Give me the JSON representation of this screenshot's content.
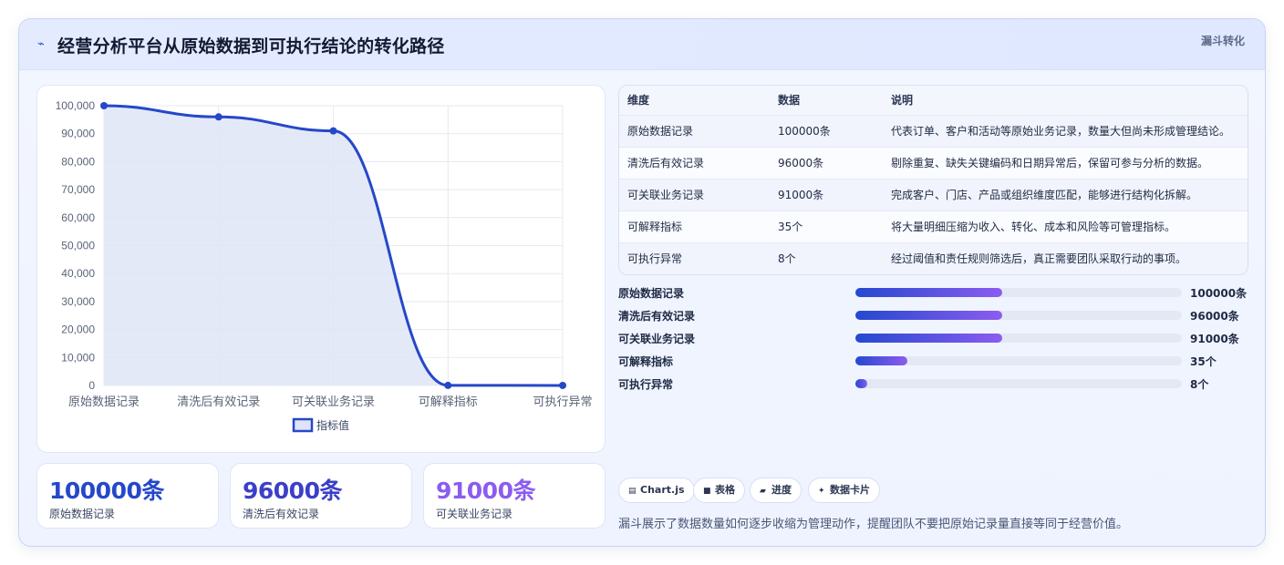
{
  "header": {
    "icon": "trend-icon",
    "title": "经营分析平台从原始数据到可执行结论的转化路径",
    "badge": "漏斗转化"
  },
  "chart_data": {
    "type": "area",
    "categories": [
      "原始数据记录",
      "清洗后有效记录",
      "可关联业务记录",
      "可解释指标",
      "可执行异常"
    ],
    "series": [
      {
        "name": "指标值",
        "values": [
          100000,
          96000,
          91000,
          35,
          8
        ]
      }
    ],
    "ylim": [
      0,
      100000
    ],
    "yticks": [
      "100,000",
      "90,000",
      "80,000",
      "70,000",
      "60,000",
      "50,000",
      "40,000",
      "30,000",
      "20,000",
      "10,000",
      "0"
    ],
    "grid": true,
    "legend": "bottom",
    "colors": {
      "line": "#2548c8",
      "fill": "#dfe5f7"
    }
  },
  "stats": [
    {
      "value": "100000条",
      "label": "原始数据记录",
      "color": "#2548c8"
    },
    {
      "value": "96000条",
      "label": "清洗后有效记录",
      "color": "#3b3fc8"
    },
    {
      "value": "91000条",
      "label": "可关联业务记录",
      "color": "#8b5cf0"
    }
  ],
  "table": {
    "headers": [
      "维度",
      "数据",
      "说明"
    ],
    "rows": [
      [
        "原始数据记录",
        "100000条",
        "代表订单、客户和活动等原始业务记录，数量大但尚未形成管理结论。"
      ],
      [
        "清洗后有效记录",
        "96000条",
        "剔除重复、缺失关键编码和日期异常后，保留可参与分析的数据。"
      ],
      [
        "可关联业务记录",
        "91000条",
        "完成客户、门店、产品或组织维度匹配，能够进行结构化拆解。"
      ],
      [
        "可解释指标",
        "35个",
        "将大量明细压缩为收入、转化、成本和风险等可管理指标。"
      ],
      [
        "可执行异常",
        "8个",
        "经过阈值和责任规则筛选后，真正需要团队采取行动的事项。"
      ]
    ]
  },
  "progress": [
    {
      "label": "原始数据记录",
      "value": "100000条",
      "fraction": 0.45
    },
    {
      "label": "清洗后有效记录",
      "value": "96000条",
      "fraction": 0.45
    },
    {
      "label": "可关联业务记录",
      "value": "91000条",
      "fraction": 0.45
    },
    {
      "label": "可解释指标",
      "value": "35个",
      "fraction": 0.16
    },
    {
      "label": "可执行异常",
      "value": "8个",
      "fraction": 0.035
    }
  ],
  "chips": [
    {
      "icon": "chart-icon",
      "label": "Chart.js"
    },
    {
      "icon": "table-icon",
      "label": "表格"
    },
    {
      "icon": "progress-icon",
      "label": "进度"
    },
    {
      "icon": "card-icon",
      "label": "数据卡片"
    }
  ],
  "footnote": "漏斗展示了数据数量如何逐步收缩为管理动作，提醒团队不要把原始记录量直接等同于经营价值。"
}
